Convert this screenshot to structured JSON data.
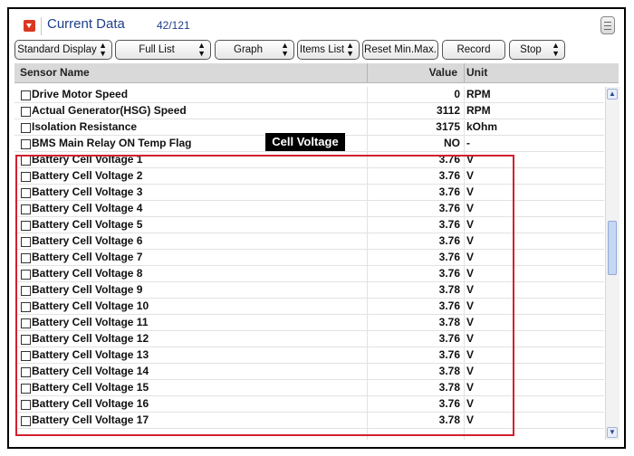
{
  "header": {
    "title": "Current Data",
    "count": "42/121"
  },
  "toolbar": {
    "standard_display": "Standard Display",
    "full_list": "Full List",
    "graph": "Graph",
    "items_list": "Items List",
    "reset_min_max": "Reset Min.Max.",
    "record": "Record",
    "stop": "Stop"
  },
  "grid": {
    "columns": {
      "name": "Sensor Name",
      "value": "Value",
      "unit": "Unit"
    },
    "rows": [
      {
        "name": "Drive Motor Speed",
        "value": "0",
        "unit": "RPM"
      },
      {
        "name": "Actual Generator(HSG) Speed",
        "value": "3112",
        "unit": "RPM"
      },
      {
        "name": "Isolation Resistance",
        "value": "3175",
        "unit": "kOhm"
      },
      {
        "name": "BMS Main Relay ON Temp Flag",
        "value": "NO",
        "unit": "-"
      },
      {
        "name": "Battery Cell Voltage 1",
        "value": "3.76",
        "unit": "V"
      },
      {
        "name": "Battery Cell Voltage 2",
        "value": "3.76",
        "unit": "V"
      },
      {
        "name": "Battery Cell Voltage 3",
        "value": "3.76",
        "unit": "V"
      },
      {
        "name": "Battery Cell Voltage 4",
        "value": "3.76",
        "unit": "V"
      },
      {
        "name": "Battery Cell Voltage 5",
        "value": "3.76",
        "unit": "V"
      },
      {
        "name": "Battery Cell Voltage 6",
        "value": "3.76",
        "unit": "V"
      },
      {
        "name": "Battery Cell Voltage 7",
        "value": "3.76",
        "unit": "V"
      },
      {
        "name": "Battery Cell Voltage 8",
        "value": "3.76",
        "unit": "V"
      },
      {
        "name": "Battery Cell Voltage 9",
        "value": "3.78",
        "unit": "V"
      },
      {
        "name": "Battery Cell Voltage 10",
        "value": "3.76",
        "unit": "V"
      },
      {
        "name": "Battery Cell Voltage 11",
        "value": "3.78",
        "unit": "V"
      },
      {
        "name": "Battery Cell Voltage 12",
        "value": "3.76",
        "unit": "V"
      },
      {
        "name": "Battery Cell Voltage 13",
        "value": "3.76",
        "unit": "V"
      },
      {
        "name": "Battery Cell Voltage 14",
        "value": "3.78",
        "unit": "V"
      },
      {
        "name": "Battery Cell Voltage 15",
        "value": "3.78",
        "unit": "V"
      },
      {
        "name": "Battery Cell Voltage 16",
        "value": "3.76",
        "unit": "V"
      },
      {
        "name": "Battery Cell Voltage 17",
        "value": "3.78",
        "unit": "V"
      }
    ]
  },
  "callout": {
    "label": "Cell Voltage"
  },
  "colors": {
    "title": "#1f3f8a",
    "highlight": "#d2202f",
    "header_bg": "#d9d9d9"
  }
}
